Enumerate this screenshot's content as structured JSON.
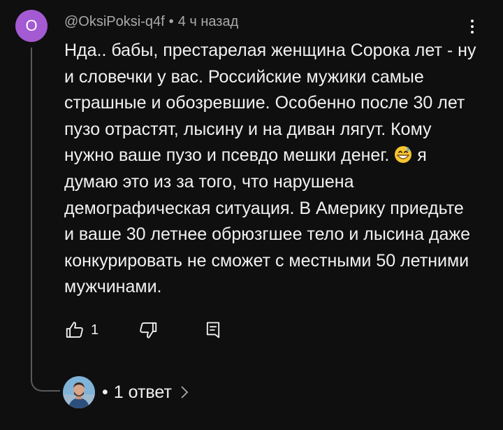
{
  "comment": {
    "avatar_letter": "O",
    "avatar_color": "#a45ad2",
    "author": "@OksiPoksi-q4f",
    "separator": "•",
    "time": "4 ч назад",
    "text_before_emoji": "Нда.. бабы, престарелая женщина Сорока лет - ну и словечки у вас. Российские мужики самые страшные и обозревшие. Особенно после 30 лет пузо отрастят, лысину и на диван лягут. Кому нужно ваше пузо и псевдо мешки денег.",
    "emoji": "grinning-face-with-sweat",
    "text_after_emoji": "я думаю это из за того, что нарушена демографическая ситуация. В Америку приедьте и ваше 30 летнее обрюзгшее тело и лысина даже конкурировать не сможет с местными 50 летними мужчинами.",
    "like_count": "1",
    "icons": {
      "like": "thumb-up-icon",
      "dislike": "thumb-down-icon",
      "reply": "reply-comment-icon",
      "more": "more-vert-icon",
      "chevron": "chevron-right-icon"
    }
  },
  "replies": {
    "bullet": "•",
    "label": "1 ответ"
  }
}
